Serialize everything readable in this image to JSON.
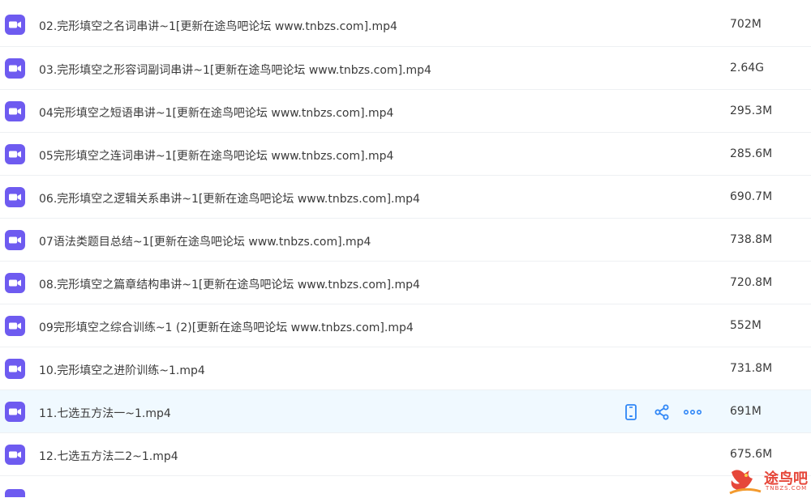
{
  "colors": {
    "icon_purple": "#6e5bf0",
    "action_blue": "#2f86f6",
    "active_row_bg": "#f0f9ff",
    "watermark_red": "#e6473a"
  },
  "files": [
    {
      "name": "02.完形填空之名词串讲~1[更新在途鸟吧论坛 www.tnbzs.com].mp4",
      "size": "702M"
    },
    {
      "name": "03.完形填空之形容词副词串讲~1[更新在途鸟吧论坛 www.tnbzs.com].mp4",
      "size": "2.64G"
    },
    {
      "name": "04完形填空之短语串讲~1[更新在途鸟吧论坛 www.tnbzs.com].mp4",
      "size": "295.3M"
    },
    {
      "name": "05完形填空之连词串讲~1[更新在途鸟吧论坛 www.tnbzs.com].mp4",
      "size": "285.6M"
    },
    {
      "name": "06.完形填空之逻辑关系串讲~1[更新在途鸟吧论坛 www.tnbzs.com].mp4",
      "size": "690.7M"
    },
    {
      "name": "07语法类题目总结~1[更新在途鸟吧论坛 www.tnbzs.com].mp4",
      "size": "738.8M"
    },
    {
      "name": "08.完形填空之篇章结构串讲~1[更新在途鸟吧论坛 www.tnbzs.com].mp4",
      "size": "720.8M"
    },
    {
      "name": "09完形填空之综合训练~1 (2)[更新在途鸟吧论坛 www.tnbzs.com].mp4",
      "size": "552M"
    },
    {
      "name": "10.完形填空之进阶训练~1.mp4",
      "size": "731.8M"
    },
    {
      "name": "11.七选五方法一~1.mp4",
      "size": "691M",
      "active": true
    },
    {
      "name": "12.七选五方法二2~1.mp4",
      "size": "675.6M"
    }
  ],
  "row_actions": [
    "phone-icon",
    "share-icon",
    "more-icon"
  ],
  "watermark": {
    "text": "途鸟吧",
    "sub": "TNBZS.COM"
  }
}
